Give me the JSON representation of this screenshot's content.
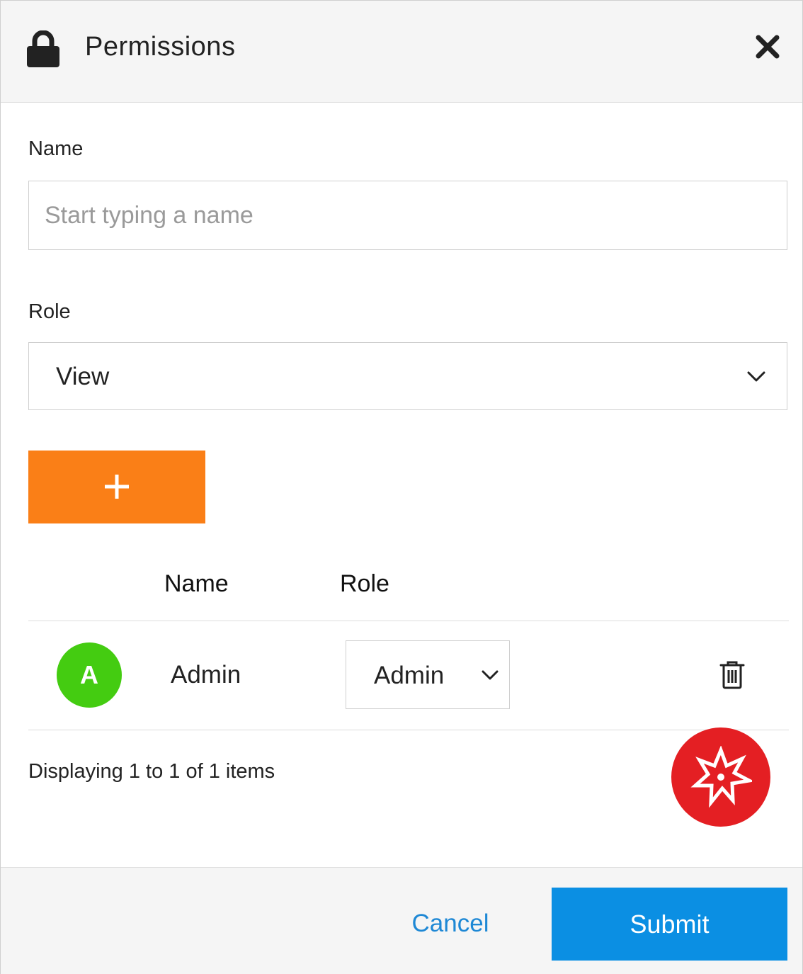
{
  "header": {
    "title": "Permissions",
    "icon": "lock-icon",
    "close_icon": "close-icon"
  },
  "form": {
    "name_label": "Name",
    "name_placeholder": "Start typing a name",
    "name_value": "",
    "role_label": "Role",
    "role_value": "View",
    "add_button_icon": "plus-icon"
  },
  "table": {
    "columns": [
      "Name",
      "Role"
    ],
    "rows": [
      {
        "avatar_initial": "A",
        "name": "Admin",
        "role": "Admin"
      }
    ],
    "paging_text": "Displaying 1 to 1 of 1 items"
  },
  "footer": {
    "cancel_label": "Cancel",
    "submit_label": "Submit"
  },
  "colors": {
    "add_button": "#fa7f17",
    "avatar": "#44cc11",
    "fab": "#e41f23",
    "submit": "#0b8fe3",
    "cancel_text": "#1e88d5"
  }
}
